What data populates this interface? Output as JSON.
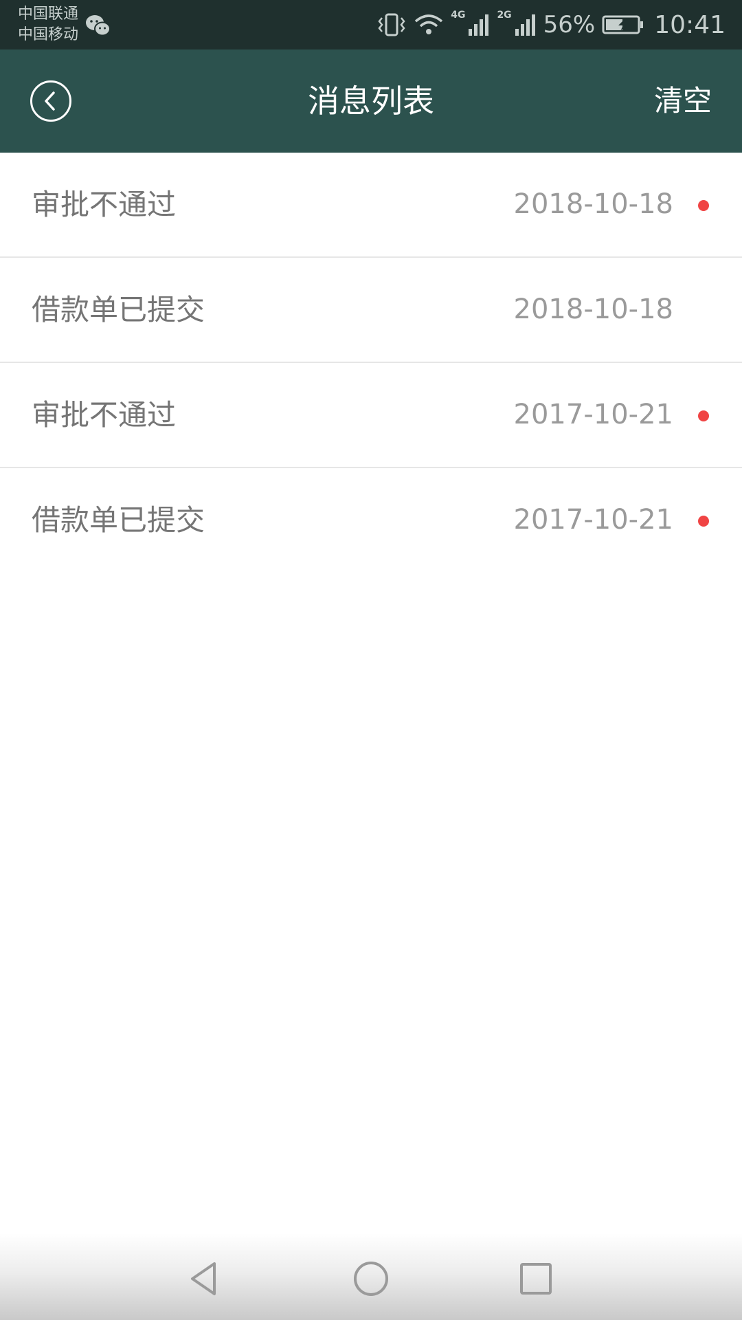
{
  "status_bar": {
    "carrier_1": "中国联通",
    "carrier_2": "中国移动",
    "notification_icon": "wechat-icon",
    "network_1": "4G",
    "network_2": "2G",
    "battery_percent": "56%",
    "time": "10:41"
  },
  "header": {
    "back_icon": "chevron-left-circle-icon",
    "title": "消息列表",
    "clear_label": "清空",
    "background_color": "#2c524e"
  },
  "messages": [
    {
      "title": "审批不通过",
      "date": "2018-10-18",
      "unread": true
    },
    {
      "title": "借款单已提交",
      "date": "2018-10-18",
      "unread": false
    },
    {
      "title": "审批不通过",
      "date": "2017-10-21",
      "unread": true
    },
    {
      "title": "借款单已提交",
      "date": "2017-10-21",
      "unread": true
    }
  ],
  "colors": {
    "status_bar": "#1f302e",
    "unread_dot": "#f04444"
  },
  "nav_bar": {
    "back_icon": "triangle-back-icon",
    "home_icon": "circle-home-icon",
    "recents_icon": "square-recents-icon"
  }
}
